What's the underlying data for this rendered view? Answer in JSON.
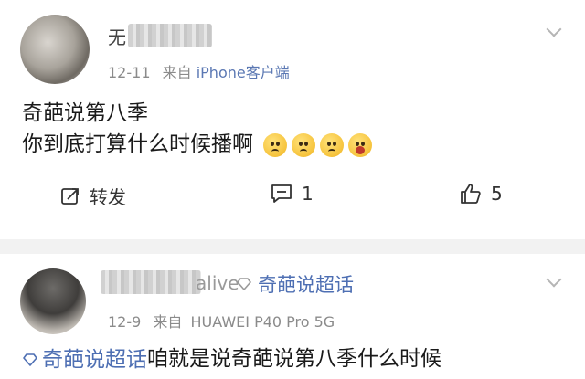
{
  "post1": {
    "username": "无",
    "time": "12-11",
    "via": "来自",
    "device": "iPhone客户端",
    "content_lines": [
      "奇葩说第八季",
      "你到底打算什么时候播啊"
    ],
    "emojis": [
      "sad-face",
      "sad-face",
      "sad-face",
      "shocked-face"
    ],
    "actions": {
      "repost_label": "转发",
      "comment_count": "1",
      "like_count": "5"
    }
  },
  "post2": {
    "username_visible": "alive",
    "topic_badge": "奇葩说超话",
    "time": "12-9",
    "via": "来自",
    "device": "HUAWEI P40 Pro 5G",
    "content_topic": "奇葩说超话",
    "content_text": "咱就是说奇葩说第八季什么时候"
  },
  "colors": {
    "link": "#5b78b3",
    "topic": "#4e6fb3",
    "meta": "#8b8b8b",
    "divider": "#f2f2f2"
  }
}
